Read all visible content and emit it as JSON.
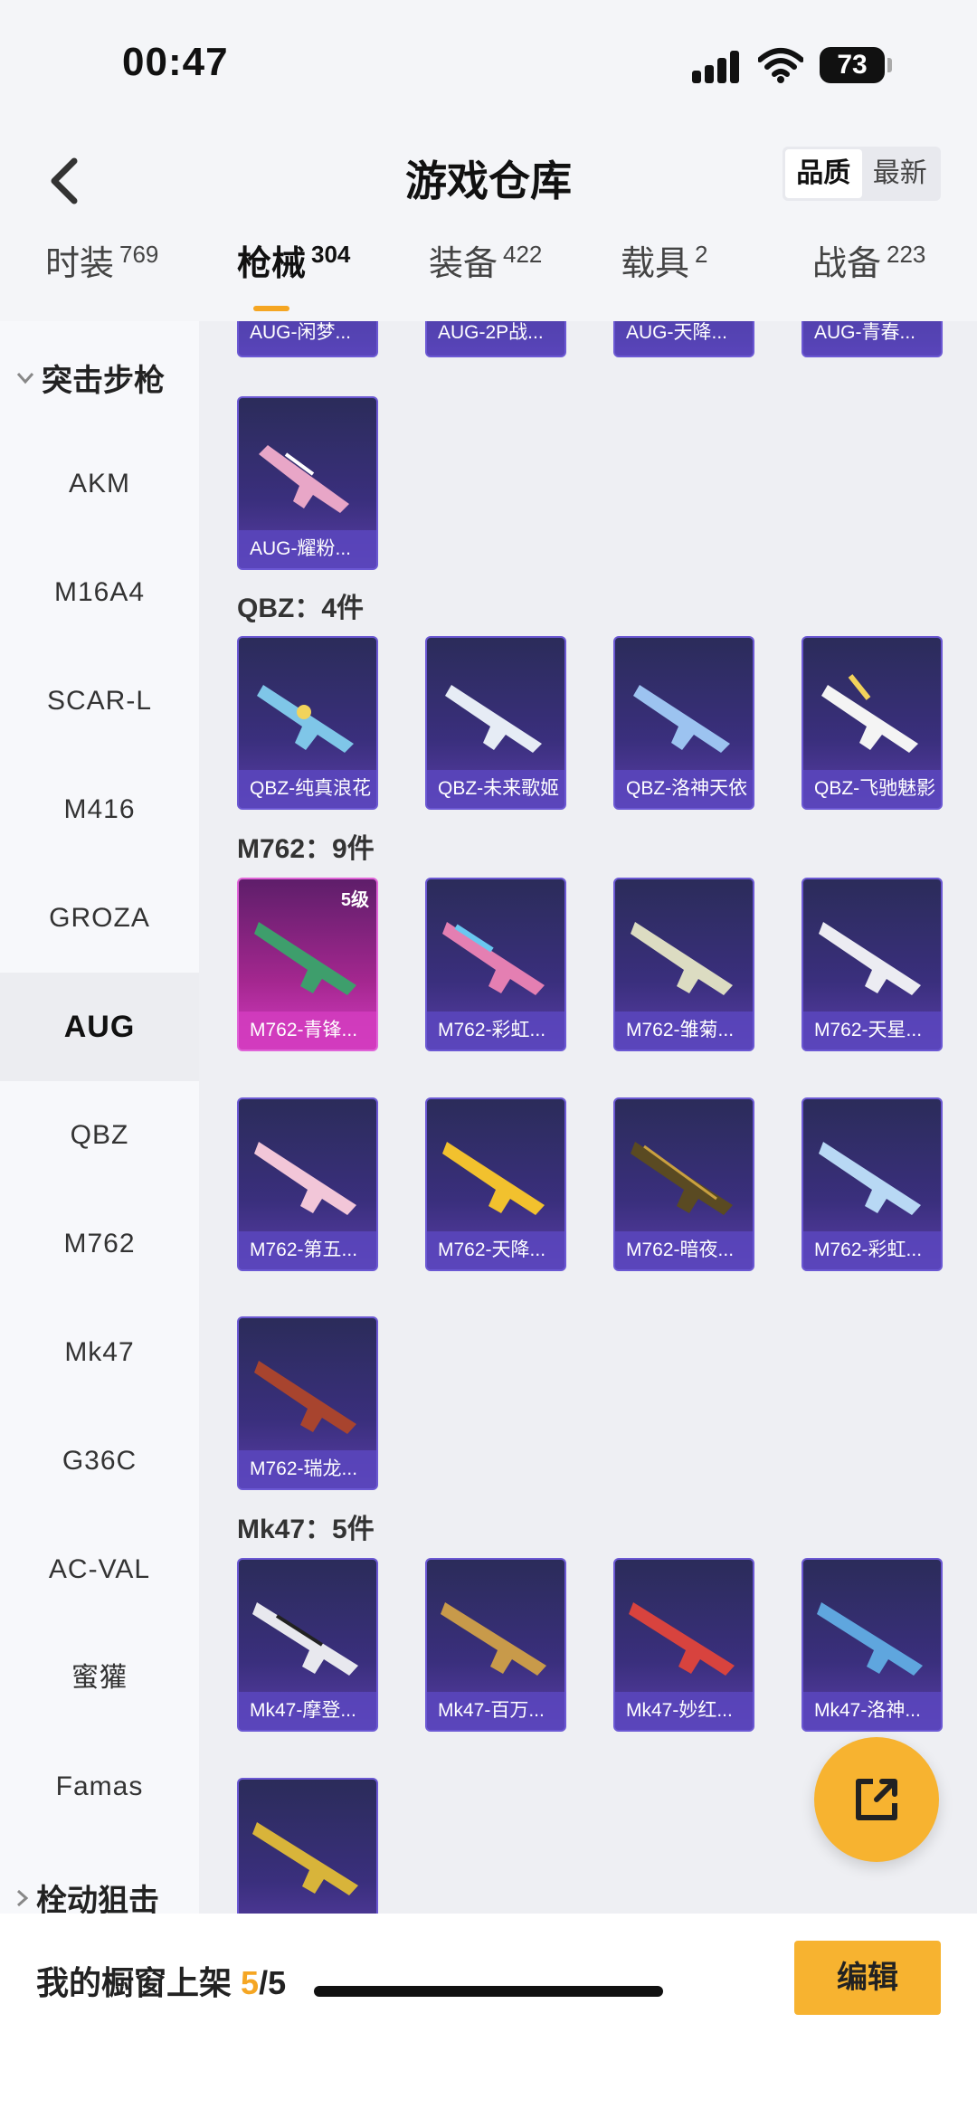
{
  "status_bar": {
    "time": "00:47",
    "battery": "73"
  },
  "header": {
    "title": "游戏仓库",
    "sort_options": [
      "品质",
      "最新"
    ],
    "sort_selected": "品质"
  },
  "tabs": [
    {
      "label": "时装",
      "count": "769"
    },
    {
      "label": "枪械",
      "count": "304",
      "active": true
    },
    {
      "label": "装备",
      "count": "422"
    },
    {
      "label": "载具",
      "count": "2"
    },
    {
      "label": "战备",
      "count": "223"
    }
  ],
  "sidebar": {
    "section_top": "突击步枪",
    "items": [
      "AKM",
      "M16A4",
      "SCAR-L",
      "M416",
      "GROZA",
      "AUG",
      "QBZ",
      "M762",
      "Mk47",
      "G36C",
      "AC-VAL",
      "蜜獾",
      "Famas"
    ],
    "active_item": "AUG",
    "section_bottom": "栓动狙击"
  },
  "groups": {
    "aug_partial": [
      "AUG-闲梦...",
      "AUG-2P战...",
      "AUG-天降...",
      "AUG-青春..."
    ],
    "aug_last": "AUG-耀粉...",
    "qbz": {
      "title": "QBZ：4件",
      "items": [
        "QBZ-纯真浪花",
        "QBZ-未来歌姬",
        "QBZ-洛神天依",
        "QBZ-飞驰魅影"
      ]
    },
    "m762": {
      "title": "M762：9件",
      "items": [
        "M762-青锋...",
        "M762-彩虹...",
        "M762-雏菊...",
        "M762-天星...",
        "M762-第五...",
        "M762-天降...",
        "M762-暗夜...",
        "M762-彩虹...",
        "M762-瑞龙..."
      ],
      "first_level": "5级"
    },
    "mk47": {
      "title": "Mk47：5件",
      "items": [
        "Mk47-摩登...",
        "Mk47-百万...",
        "Mk47-妙红...",
        "Mk47-洛神..."
      ]
    }
  },
  "bottom": {
    "shelf_label": "我的橱窗上架",
    "shelf_current": "5",
    "shelf_total": "/5",
    "edit_label": "编辑"
  },
  "colors": {
    "accent": "#f5a623",
    "card_purple": "#3a2f7d",
    "card_gold": "#a4278f"
  },
  "icons": {
    "back": "chevron-left-icon",
    "fab": "share-external-icon"
  }
}
